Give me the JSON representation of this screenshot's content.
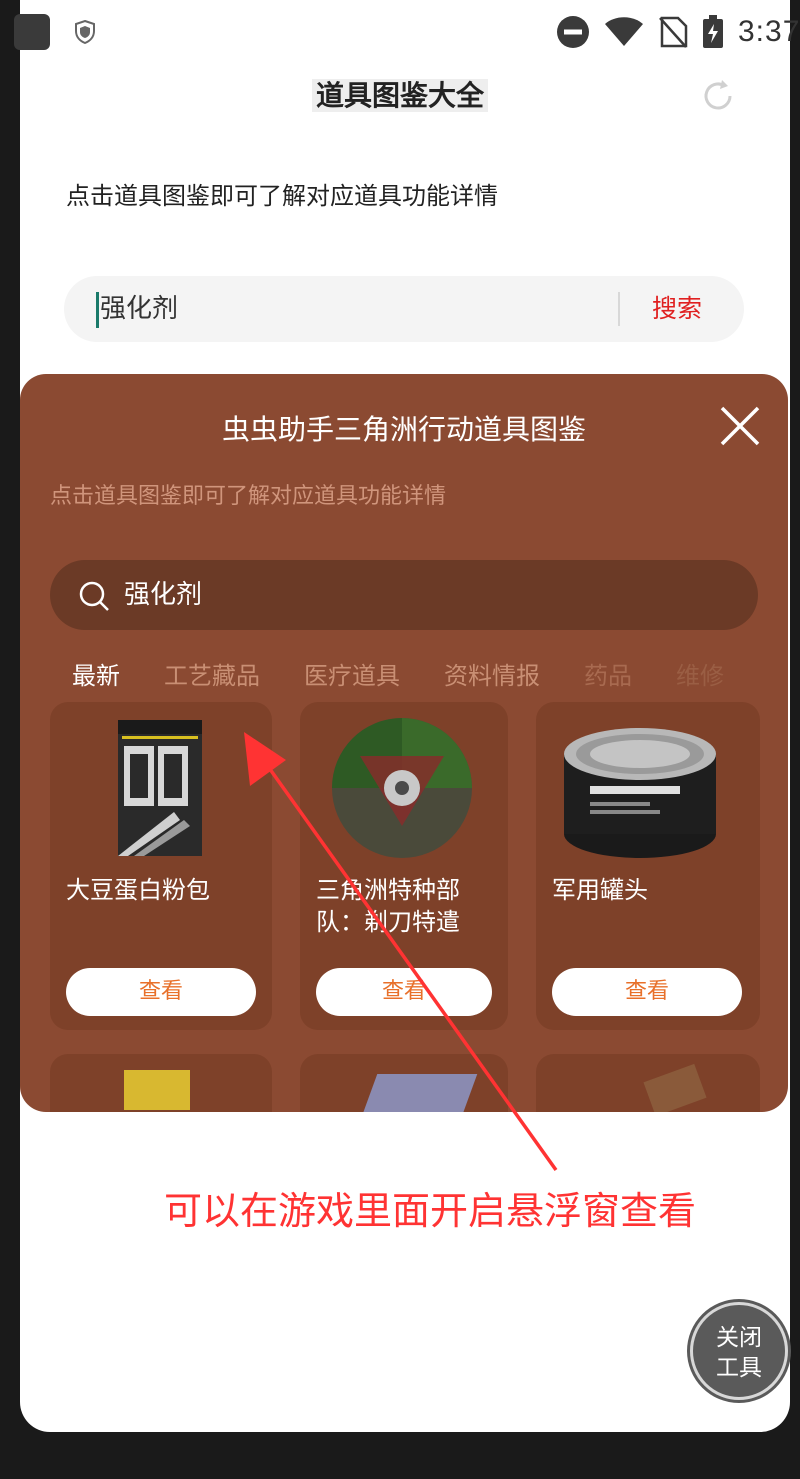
{
  "status_bar": {
    "time": "3:37"
  },
  "header": {
    "title": "道具图鉴大全"
  },
  "subtitle": "点击道具图鉴即可了解对应道具功能详情",
  "search": {
    "value": "强化剂",
    "button_label": "搜索"
  },
  "overlay": {
    "title": "虫虫助手三角洲行动道具图鉴",
    "subtitle": "点击道具图鉴即可了解对应道具功能详情",
    "search_value": "强化剂",
    "tabs": [
      "最新",
      "工艺藏品",
      "医疗道具",
      "资料情报",
      "药品",
      "维修"
    ],
    "items": [
      {
        "name": "大豆蛋白粉包",
        "button": "查看"
      },
      {
        "name": "三角洲特种部队：剃刀特遣",
        "button": "查看"
      },
      {
        "name": "军用罐头",
        "button": "查看"
      }
    ]
  },
  "annotation": "可以在游戏里面开启悬浮窗查看",
  "tool_button": {
    "line1": "关闭",
    "line2": "工具"
  },
  "colors": {
    "overlay_bg": "#8b4a32",
    "accent_red": "#e02020",
    "button_orange": "#e8702a"
  }
}
